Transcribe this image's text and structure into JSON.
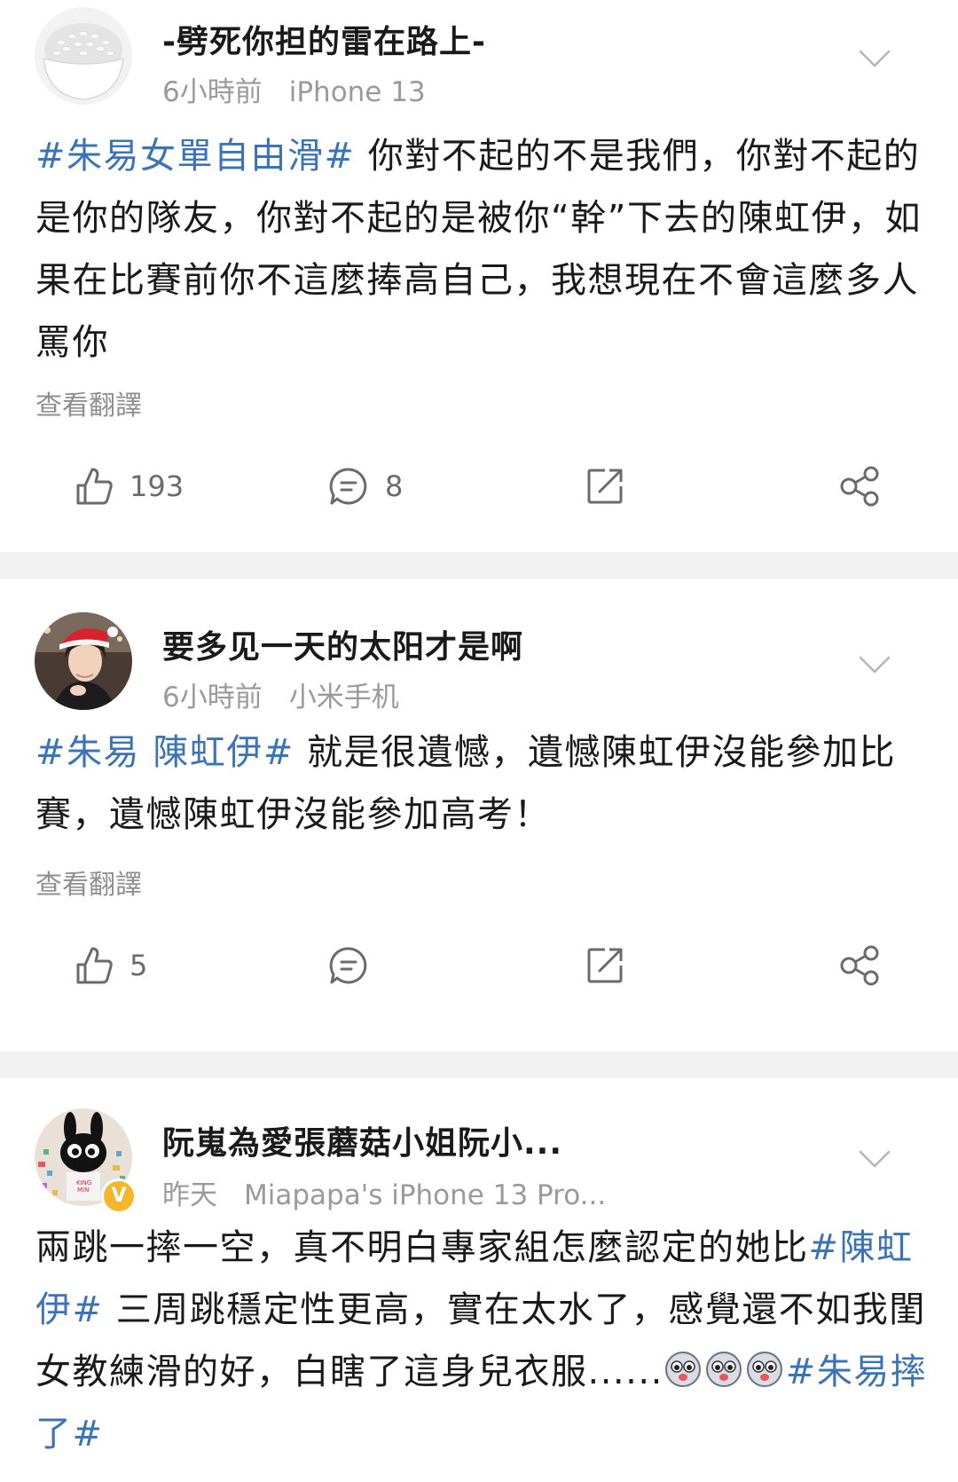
{
  "posts": [
    {
      "username": "-劈死你担的雷在路上-",
      "time": "6小時前",
      "device": "iPhone 13",
      "content": {
        "tag1": "#朱易女單自由滑#",
        "text": " 你對不起的不是我們，你對不起的是你的隊友，你對不起的是被你“幹”下去的陳虹伊，如果在比賽前你不這麼捧高自己，我想現在不會這麼多人罵你"
      },
      "translate_label": "查看翻譯",
      "likes": "193",
      "comments": "8",
      "avatar_icon": "rice-bowl-avatar"
    },
    {
      "username": "要多见一天的太阳才是啊",
      "time": "6小時前",
      "device": "小米手机",
      "content": {
        "tag1": "#朱易 陳虹伊#",
        "text": " 就是很遺憾，遺憾陳虹伊沒能參加比賽，遺憾陳虹伊沒能參加高考！"
      },
      "translate_label": "查看翻譯",
      "likes": "5",
      "comments": "",
      "avatar_icon": "santa-hat-girl-avatar"
    },
    {
      "username": "阮嵬為愛張蘑菇小姐阮小...",
      "time": "昨天",
      "device": "Miapapa's iPhone 13 Pro...",
      "verified_badge": "V",
      "content": {
        "text1": "兩跳一摔一空，真不明白專家組怎麼認定的她比",
        "tag1": "#陳虹伊#",
        "text2": " 三周跳穩定性更高，實在太水了，感覺還不如我閨女教練滑的好，白瞎了這身兒衣服......",
        "tag2": "#朱易摔了#"
      },
      "emoji_icon": "dog-face-emoji",
      "avatar_icon": "black-rabbit-avatar"
    }
  ],
  "icons": {
    "like": "thumbs-up-icon",
    "comment": "comment-icon",
    "repost": "repost-icon",
    "share": "share-icon",
    "more": "chevron-down-icon"
  },
  "colors": {
    "hashtag": "#3b73b8",
    "meta_text": "#9a9a9a",
    "divider": "#f1f1f1",
    "verified": "#f5b52d"
  }
}
